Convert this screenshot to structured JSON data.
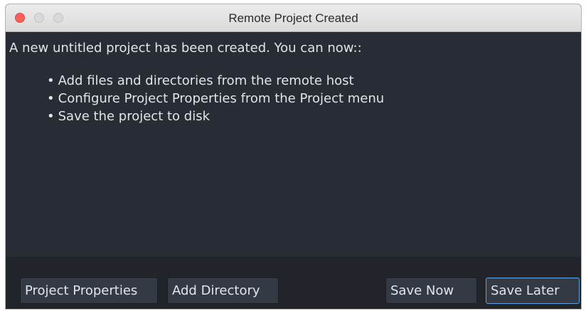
{
  "window": {
    "title": "Remote Project Created"
  },
  "message": {
    "intro": "A new untitled project has been created. You can now::",
    "bullets": [
      "Add files and directories from the remote host",
      "Configure Project Properties from the Project menu",
      "Save the project to disk"
    ]
  },
  "buttons": {
    "project_properties": "Project Properties",
    "add_directory": "Add Directory",
    "save_now": "Save Now",
    "save_later": "Save Later"
  },
  "colors": {
    "close_button": "#fc605c",
    "background": "#282c34",
    "focus_border": "#5ea0dc"
  }
}
